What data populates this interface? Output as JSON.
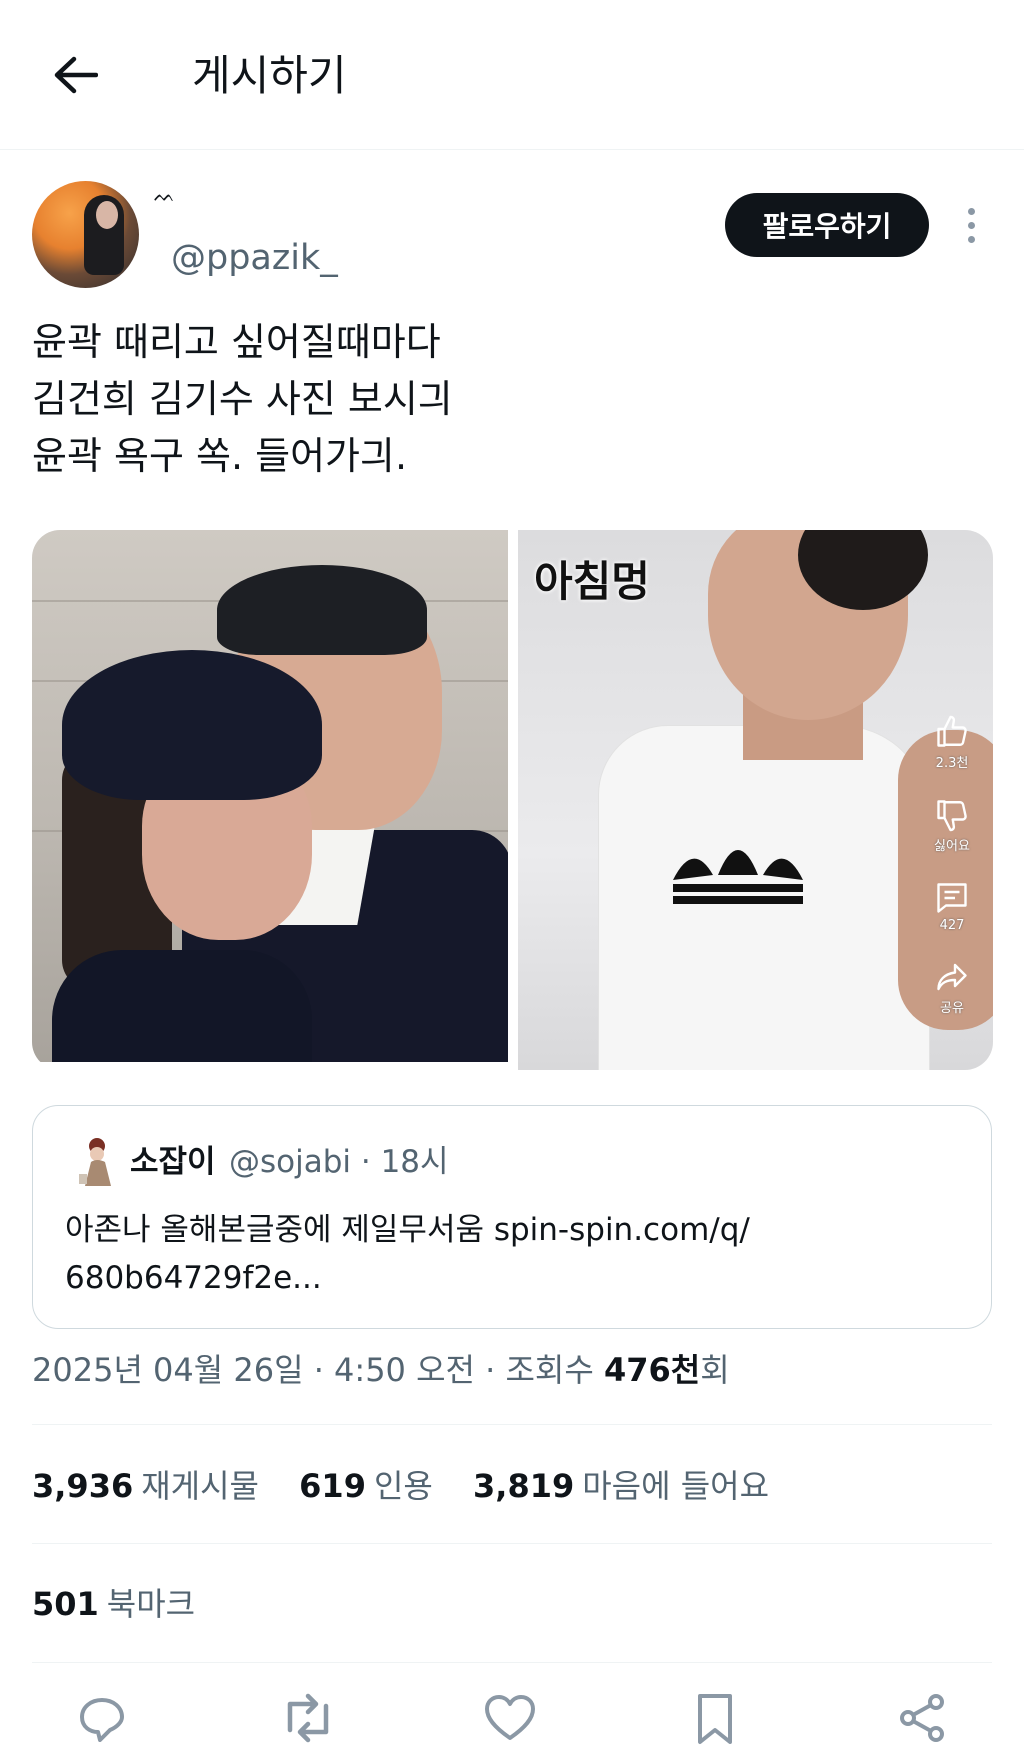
{
  "header": {
    "title": "게시하기",
    "back_icon": "arrow-left-icon"
  },
  "author": {
    "display_name": "ᨓ",
    "handle": "@ppazik_",
    "follow_label": "팔로우하기",
    "more_icon": "more-vertical-icon"
  },
  "post": {
    "lines": [
      "윤곽 때리고 싶어질때마다",
      "김건희 김기수 사진 보시긔",
      "윤곽 욕구 쏙. 들어가긔."
    ]
  },
  "media": {
    "right_caption": "아침멍",
    "side_actions": [
      {
        "icon": "thumbs-up-icon",
        "label": "2.3천"
      },
      {
        "icon": "thumbs-down-icon",
        "label": "싫어요"
      },
      {
        "icon": "comment-icon",
        "label": "427"
      },
      {
        "icon": "share-arrow-icon",
        "label": "공유"
      }
    ]
  },
  "quote": {
    "name": "소잡이",
    "meta": "@sojabi · 18시",
    "text_line1": "아존나 올해본글중에 제일무서움  spin-spin.com/q/",
    "text_line2": "680b64729f2e..."
  },
  "timestamp": {
    "prefix": "2025년 04월 26일 · 4:50 오전 · 조회수 ",
    "views": "476천",
    "suffix": "회"
  },
  "stats": {
    "reposts_count": "3,936",
    "reposts_label": "재게시물",
    "quotes_count": "619",
    "quotes_label": "인용",
    "likes_count": "3,819",
    "likes_label": "마음에 들어요"
  },
  "bookmarks": {
    "count": "501",
    "label": "북마크"
  },
  "actions": [
    "reply-icon",
    "repost-icon",
    "like-icon",
    "bookmark-icon",
    "share-icon"
  ],
  "colors": {
    "text": "#0f1419",
    "secondary": "#536471",
    "border": "#cfd9de",
    "icon": "#8b98a5"
  }
}
